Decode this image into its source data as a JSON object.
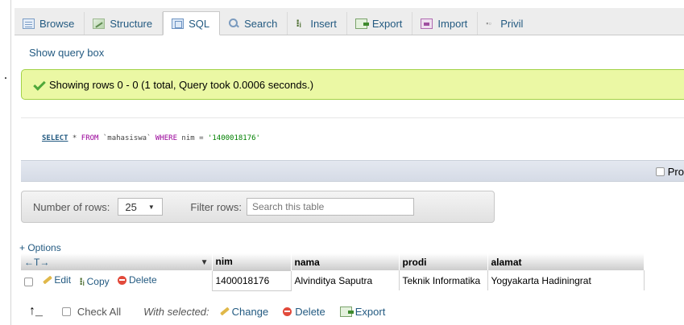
{
  "tabs": [
    {
      "label": "Browse",
      "icon": "browse-icon",
      "active": false
    },
    {
      "label": "Structure",
      "icon": "structure-icon",
      "active": false
    },
    {
      "label": "SQL",
      "icon": "sql-icon",
      "active": true
    },
    {
      "label": "Search",
      "icon": "search-icon",
      "active": false
    },
    {
      "label": "Insert",
      "icon": "insert-icon",
      "active": false
    },
    {
      "label": "Export",
      "icon": "export-icon",
      "active": false
    },
    {
      "label": "Import",
      "icon": "import-icon",
      "active": false
    },
    {
      "label": "Privil",
      "icon": "privileges-icon",
      "active": false
    }
  ],
  "show_query_box": "Show query box",
  "success_message": "Showing rows 0 - 0 (1 total, Query took 0.0006 seconds.)",
  "sql": {
    "select": "SELECT",
    "star": " * ",
    "from": "FROM",
    "table": " `mahasiswa` ",
    "where": "WHERE",
    "cond": " nim = ",
    "value": "'1400018176'"
  },
  "profiling_label": "Pro",
  "nav": {
    "rows_label": "Number of rows:",
    "rows_value": "25",
    "filter_label": "Filter rows:",
    "filter_placeholder": "Search this table"
  },
  "options_label": "+ Options",
  "table": {
    "arrows": "←T→",
    "columns": [
      "nim",
      "nama",
      "prodi",
      "alamat"
    ],
    "row_actions": {
      "edit": "Edit",
      "copy": "Copy",
      "delete": "Delete"
    },
    "rows": [
      [
        "1400018176",
        "Alvinditya Saputra",
        "Teknik Informatika",
        "Yogyakarta Hadiningrat"
      ]
    ]
  },
  "bottom": {
    "check_all": "Check All",
    "with_selected": "With selected:",
    "change": "Change",
    "delete": "Delete",
    "export": "Export"
  },
  "colors": {
    "link": "#235a81",
    "success_bg": "#ebf8a4",
    "success_border": "#a2d246"
  }
}
